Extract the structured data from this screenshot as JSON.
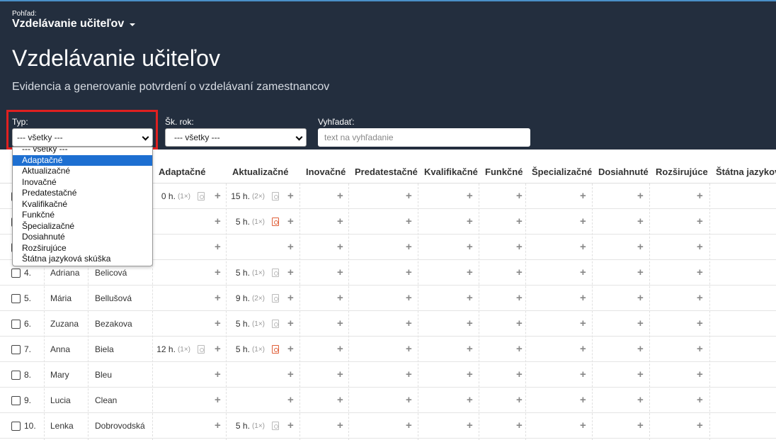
{
  "header": {
    "view_label": "Pohľad:",
    "view_name": "Vzdelávanie učiteľov",
    "title": "Vzdelávanie učiteľov",
    "subtitle": "Evidencia a generovanie potvrdení o vzdelávaní zamestnancov"
  },
  "filters": {
    "type_label": "Typ:",
    "type_value": "--- všetky ---",
    "year_label": "Šk. rok:",
    "year_value": "--- všetky ---",
    "search_label": "Vyhľadať:",
    "search_placeholder": "text na vyhľadanie"
  },
  "dropdown": {
    "selected_index": 1,
    "options": [
      "--- všetky ---",
      "Adaptačné",
      "Aktualizačné",
      "Inovačné",
      "Predatestačné",
      "Kvalifikačné",
      "Funkčné",
      "Špecializačné",
      "Dosiahnuté",
      "Rozširujúce",
      "Štátna jazyková skúška"
    ]
  },
  "table": {
    "columns": [
      "Adaptačné",
      "Aktualizačné",
      "Inovačné",
      "Predatestačné",
      "Kvalifikačné",
      "Funkčné",
      "Špecializačné",
      "Dosiahnuté",
      "Rozširujúce",
      "Štátna jazykova"
    ],
    "rows": [
      {
        "num": "",
        "first": "",
        "last": "",
        "adapt": {
          "hours": "0 h.",
          "count": "(1×)",
          "pdf": "gray"
        },
        "aktual": {
          "hours": "15 h.",
          "count": "(2×)",
          "pdf": "gray"
        }
      },
      {
        "num": "",
        "first": "",
        "last": "",
        "adapt": null,
        "aktual": {
          "hours": "5 h.",
          "count": "(1×)",
          "pdf": "red"
        }
      },
      {
        "num": "",
        "first": "",
        "last": "",
        "adapt": null,
        "aktual": null
      },
      {
        "num": "4.",
        "first": "Adriana",
        "last": "Belicová",
        "adapt": null,
        "aktual": {
          "hours": "5 h.",
          "count": "(1×)",
          "pdf": "gray"
        }
      },
      {
        "num": "5.",
        "first": "Mária",
        "last": "Bellušová",
        "adapt": null,
        "aktual": {
          "hours": "9 h.",
          "count": "(2×)",
          "pdf": "gray"
        }
      },
      {
        "num": "6.",
        "first": "Zuzana",
        "last": "Bezakova",
        "adapt": null,
        "aktual": {
          "hours": "5 h.",
          "count": "(1×)",
          "pdf": "gray"
        }
      },
      {
        "num": "7.",
        "first": "Anna",
        "last": "Biela",
        "adapt": {
          "hours": "12 h.",
          "count": "(1×)",
          "pdf": "gray"
        },
        "aktual": {
          "hours": "5 h.",
          "count": "(1×)",
          "pdf": "red"
        }
      },
      {
        "num": "8.",
        "first": "Mary",
        "last": "Bleu",
        "adapt": null,
        "aktual": null
      },
      {
        "num": "9.",
        "first": "Lucia",
        "last": "Clean",
        "adapt": null,
        "aktual": null
      },
      {
        "num": "10.",
        "first": "Lenka",
        "last": "Dobrovodská",
        "adapt": null,
        "aktual": {
          "hours": "5 h.",
          "count": "(1×)",
          "pdf": "gray"
        }
      }
    ]
  },
  "colors": {
    "header_bg": "#232e3e",
    "highlight": "#e02020",
    "selected_option": "#1d6fd1",
    "pdf_red": "#e0603a"
  },
  "icons": {
    "add": "plus-icon",
    "pdf": "pdf-icon",
    "view_toggle": "caret-down-icon"
  }
}
